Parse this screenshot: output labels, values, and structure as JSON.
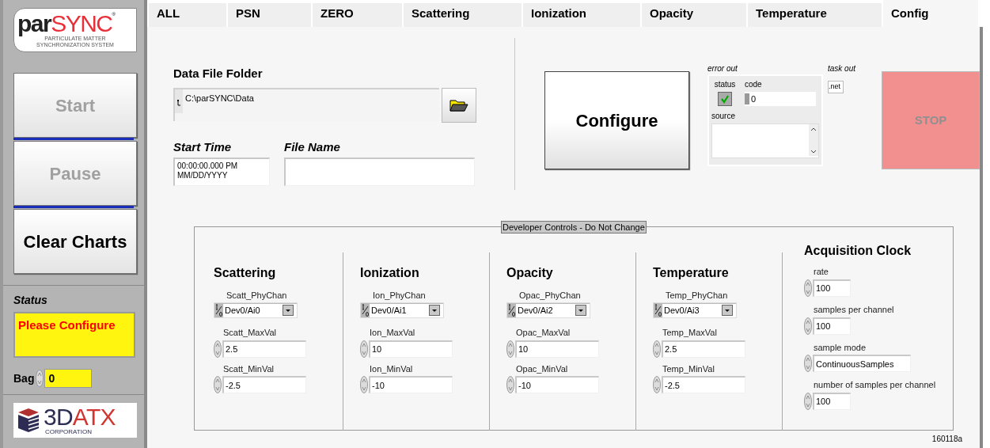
{
  "logo": {
    "part_dark": "par",
    "part_red": "SYNC",
    "mark": "®",
    "tagline": "PARTICULATE MATTER SYNCHRONIZATION SYSTEM"
  },
  "side_buttons": [
    {
      "label": "Start",
      "disabled": true
    },
    {
      "label": "Pause",
      "disabled": true
    },
    {
      "label": "Clear Charts",
      "disabled": false
    }
  ],
  "status": {
    "label": "Status",
    "value": "Please Configure"
  },
  "bag": {
    "label": "Bag",
    "value": "0"
  },
  "company_logo": {
    "part_dark": "3D",
    "part_red": "ATX",
    "subtitle": "CORPORATION"
  },
  "tabs": [
    {
      "label": "ALL",
      "selected": false
    },
    {
      "label": "PSN",
      "selected": false
    },
    {
      "label": "ZERO",
      "selected": false
    },
    {
      "label": "Scattering",
      "selected": false
    },
    {
      "label": "Ionization",
      "selected": false
    },
    {
      "label": "Opacity",
      "selected": false
    },
    {
      "label": "Temperature",
      "selected": false
    },
    {
      "label": "Config",
      "selected": true
    }
  ],
  "data_file_folder": {
    "label": "Data File Folder",
    "value": "C:\\parSYNC\\Data"
  },
  "start_time": {
    "label": "Start Time",
    "value": "00:00:00.000 PM\nMM/DD/YYYY"
  },
  "file_name": {
    "label": "File Name"
  },
  "configure_button": {
    "label": "Configure"
  },
  "error_out": {
    "label": "error out",
    "status_label": "status",
    "status": true,
    "code_label": "code",
    "code": "0",
    "source_label": "source"
  },
  "task_out": {
    "label": "task out",
    "value": ".net"
  },
  "stop_button": {
    "label": "STOP"
  },
  "developer_controls": {
    "title": "Developer Controls - Do Not Change",
    "channels": [
      {
        "title": "Scattering",
        "phychan_label": "Scatt_PhyChan",
        "phychan": "Dev0/Ai0",
        "max_label": "Scatt_MaxVal",
        "max": "2.5",
        "min_label": "Scatt_MinVal",
        "min": "-2.5"
      },
      {
        "title": "Ionization",
        "phychan_label": "Ion_PhyChan",
        "phychan": "Dev0/Ai1",
        "max_label": "Ion_MaxVal",
        "max": "10",
        "min_label": "Ion_MinVal",
        "min": "-10"
      },
      {
        "title": "Opacity",
        "phychan_label": "Opac_PhyChan",
        "phychan": "Dev0/Ai2",
        "max_label": "Opac_MaxVal",
        "max": "10",
        "min_label": "Opac_MinVal",
        "min": "-10"
      },
      {
        "title": "Temperature",
        "phychan_label": "Temp_PhyChan",
        "phychan": "Dev0/Ai3",
        "max_label": "Temp_MaxVal",
        "max": "2.5",
        "min_label": "Temp_MinVal",
        "min": "-2.5"
      }
    ],
    "acquisition_clock": {
      "title": "Acquisition Clock",
      "fields": [
        {
          "label": "rate",
          "value": "100"
        },
        {
          "label": "samples per channel",
          "value": "100"
        },
        {
          "label": "sample mode",
          "value": "ContinuousSamples"
        },
        {
          "label": "number of samples per channel",
          "value": "100"
        }
      ]
    }
  },
  "version": "160118a"
}
